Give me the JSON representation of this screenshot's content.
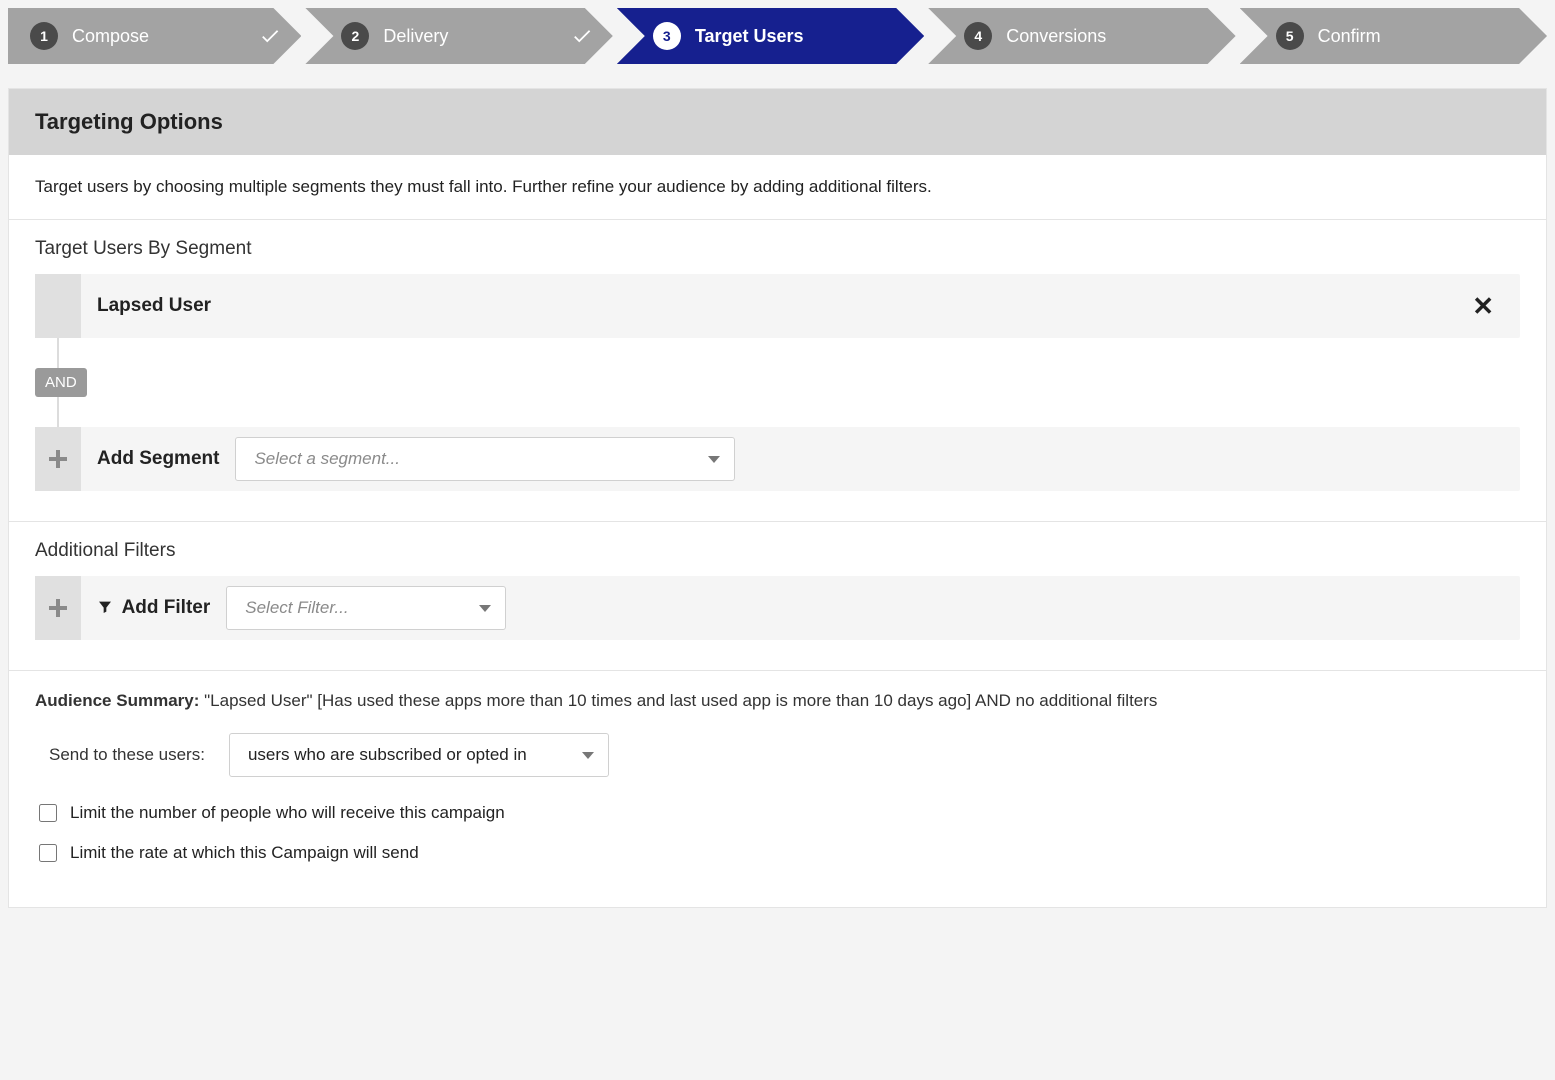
{
  "stepper": {
    "steps": [
      {
        "num": "1",
        "label": "Compose",
        "done": true,
        "active": false
      },
      {
        "num": "2",
        "label": "Delivery",
        "done": true,
        "active": false
      },
      {
        "num": "3",
        "label": "Target Users",
        "done": false,
        "active": true
      },
      {
        "num": "4",
        "label": "Conversions",
        "done": false,
        "active": false
      },
      {
        "num": "5",
        "label": "Confirm",
        "done": false,
        "active": false
      }
    ]
  },
  "panel": {
    "title": "Targeting Options",
    "description": "Target users by choosing multiple segments they must fall into. Further refine your audience by adding additional filters."
  },
  "segments": {
    "heading": "Target Users By Segment",
    "rows": [
      {
        "name": "Lapsed User"
      }
    ],
    "connector_label": "AND",
    "add_label": "Add Segment",
    "add_placeholder": "Select a segment..."
  },
  "filters": {
    "heading": "Additional Filters",
    "add_label": "Add Filter",
    "add_placeholder": "Select Filter..."
  },
  "summary": {
    "label": "Audience Summary:",
    "text": "\"Lapsed User\" [Has used these apps more than 10 times and last used app is more than 10 days ago] AND no additional filters",
    "send_label": "Send to these users:",
    "send_selected": "users who are subscribed or opted in",
    "limit_people": "Limit the number of people who will receive this campaign",
    "limit_rate": "Limit the rate at which this Campaign will send"
  }
}
